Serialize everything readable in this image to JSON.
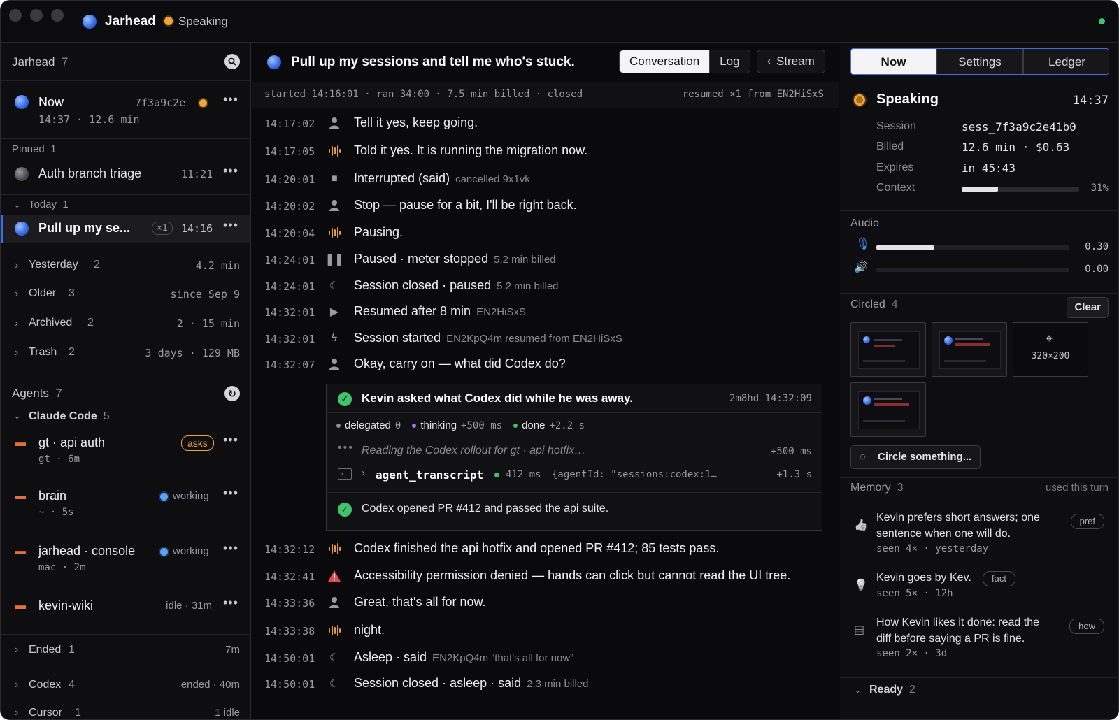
{
  "titlebar": {
    "app": "Jarhead",
    "status": "Speaking"
  },
  "left": {
    "header": {
      "title": "Jarhead",
      "count": "7"
    },
    "now": {
      "label": "Now",
      "id": "7f3a9c2e",
      "meta": "14:37 · 12.6 min"
    },
    "pinned": {
      "label": "Pinned",
      "count": "1",
      "item": "Auth branch triage",
      "time": "11:21"
    },
    "today": {
      "label": "Today",
      "count": "1",
      "item": "Pull up my se...",
      "badge": "×1",
      "time": "14:16"
    },
    "groups": [
      {
        "label": "Yesterday",
        "count": "2",
        "meta": "4.2 min"
      },
      {
        "label": "Older",
        "count": "3",
        "meta": "since Sep 9"
      },
      {
        "label": "Archived",
        "count": "2",
        "meta": "2 · 15 min"
      },
      {
        "label": "Trash",
        "count": "2",
        "meta": "3 days · 129 MB"
      }
    ],
    "agents": {
      "label": "Agents",
      "count": "7",
      "claude": {
        "label": "Claude Code",
        "count": "5"
      },
      "items": [
        {
          "name": "gt · api auth",
          "sub": "gt · 6m",
          "status": "asks"
        },
        {
          "name": "brain",
          "sub": "~ · 5s",
          "status": "working"
        },
        {
          "name": "jarhead · console",
          "sub": "mac · 2m",
          "status": "working"
        },
        {
          "name": "kevin-wiki",
          "sub": "",
          "status": "idle · 31m"
        }
      ],
      "ended": {
        "label": "Ended",
        "count": "1",
        "meta": "7m"
      },
      "codex": {
        "label": "Codex",
        "count": "4",
        "meta": "ended · 40m"
      },
      "cursor": {
        "label": "Cursor",
        "count": "1",
        "meta": "1 idle"
      }
    }
  },
  "mid": {
    "title": "Pull up my sessions and tell me who's stuck.",
    "tabs": {
      "conversation": "Conversation",
      "log": "Log",
      "stream": "Stream"
    },
    "status_left": "started 14:16:01 · ran 34:00 · 7.5 min billed · closed",
    "status_right": "resumed ×1 from EN2HiSxS",
    "lines": [
      {
        "ts": "14:17:02",
        "icon": "user",
        "text": "Tell it yes, keep going.",
        "sub": ""
      },
      {
        "ts": "14:17:05",
        "icon": "wave",
        "text": "Told it yes. It is running the migration now.",
        "sub": ""
      },
      {
        "ts": "14:20:01",
        "icon": "stop",
        "text": "Interrupted (said)",
        "sub": "cancelled 9x1vk"
      },
      {
        "ts": "14:20:02",
        "icon": "user",
        "text": "Stop — pause for a bit, I'll be right back.",
        "sub": ""
      },
      {
        "ts": "14:20:04",
        "icon": "wave",
        "text": "Pausing.",
        "sub": ""
      },
      {
        "ts": "14:24:01",
        "icon": "pause",
        "text": "Paused · meter stopped",
        "sub": "5.2 min billed"
      },
      {
        "ts": "14:24:01",
        "icon": "moon",
        "text": "Session closed · paused",
        "sub": "5.2 min billed"
      },
      {
        "ts": "14:32:01",
        "icon": "play",
        "text": "Resumed after 8 min",
        "sub": "EN2HiSxS"
      },
      {
        "ts": "14:32:01",
        "icon": "bolt",
        "text": "Session started",
        "sub": "EN2KpQ4m   resumed from EN2HiSxS"
      },
      {
        "ts": "14:32:07",
        "icon": "user",
        "text": "Okay, carry on — what did Codex do?",
        "sub": ""
      }
    ],
    "card": {
      "title": "Kevin asked what Codex did while he was away.",
      "meta": "2m8hd  14:32:09",
      "chips": [
        {
          "label": "delegated",
          "val": "0"
        },
        {
          "label": "thinking",
          "val": "+500 ms"
        },
        {
          "label": "done",
          "val": "+2.2 s"
        }
      ],
      "reading": "Reading the Codex rollout for gt · api hotfix…",
      "reading_time": "+500 ms",
      "tool": "agent_transcript",
      "tool_ms": "412 ms",
      "tool_args": "{agentId: \"sessions:codex:1…",
      "tool_time": "+1.3 s",
      "result": "Codex opened PR #412 and passed the api suite."
    },
    "lines2": [
      {
        "ts": "14:32:12",
        "icon": "wave",
        "text": "Codex finished the api hotfix and opened PR #412; 85 tests pass.",
        "sub": ""
      },
      {
        "ts": "14:32:41",
        "icon": "warn",
        "text": "Accessibility permission denied — hands can click but cannot read the UI tree.",
        "sub": ""
      },
      {
        "ts": "14:33:36",
        "icon": "user",
        "text": "Great, that's all for now.",
        "sub": ""
      },
      {
        "ts": "14:33:38",
        "icon": "wave",
        "text": "night.",
        "sub": ""
      },
      {
        "ts": "14:50:01",
        "icon": "sleep",
        "text": "Asleep · said",
        "sub": "EN2KpQ4m  “that's all for now”"
      },
      {
        "ts": "14:50:01",
        "icon": "moon",
        "text": "Session closed · asleep · said",
        "sub": "2.3 min billed"
      }
    ]
  },
  "right": {
    "tabs": {
      "now": "Now",
      "settings": "Settings",
      "ledger": "Ledger"
    },
    "speaking": {
      "label": "Speaking",
      "time": "14:37"
    },
    "session": {
      "k": "Session",
      "v": "sess_7f3a9c2e41b0"
    },
    "billed": {
      "k": "Billed",
      "v": "12.6 min · $0.63"
    },
    "expires": {
      "k": "Expires",
      "v": "in 45:43"
    },
    "context": {
      "k": "Context",
      "pct": "31%",
      "fill": 0.31
    },
    "audio": {
      "label": "Audio",
      "mic": "0.30",
      "mic_fill": 0.3,
      "spk": "0.00",
      "spk_fill": 0.0
    },
    "circled": {
      "label": "Circled",
      "count": "4",
      "clear": "Clear",
      "size": "320×200",
      "button": "Circle something..."
    },
    "memory": {
      "label": "Memory",
      "count": "3",
      "note": "used this turn",
      "items": [
        {
          "text": "Kevin prefers short answers; one sentence when one will do.",
          "meta": "seen 4× · yesterday",
          "tag": "pref"
        },
        {
          "text": "Kevin goes by Kev.",
          "meta": "seen 5× · 12h",
          "tag": "fact"
        },
        {
          "text": "How Kevin likes it done: read the diff before saying a PR is fine.",
          "meta": "seen 2× · 3d",
          "tag": "how"
        }
      ]
    },
    "ready": {
      "label": "Ready",
      "count": "2"
    }
  },
  "colors": {
    "accent": "#f0a53a",
    "blue": "#3c6fe8",
    "ok": "#3ec46d",
    "warn": "#e5484d",
    "bg": "#0b0b0d"
  }
}
